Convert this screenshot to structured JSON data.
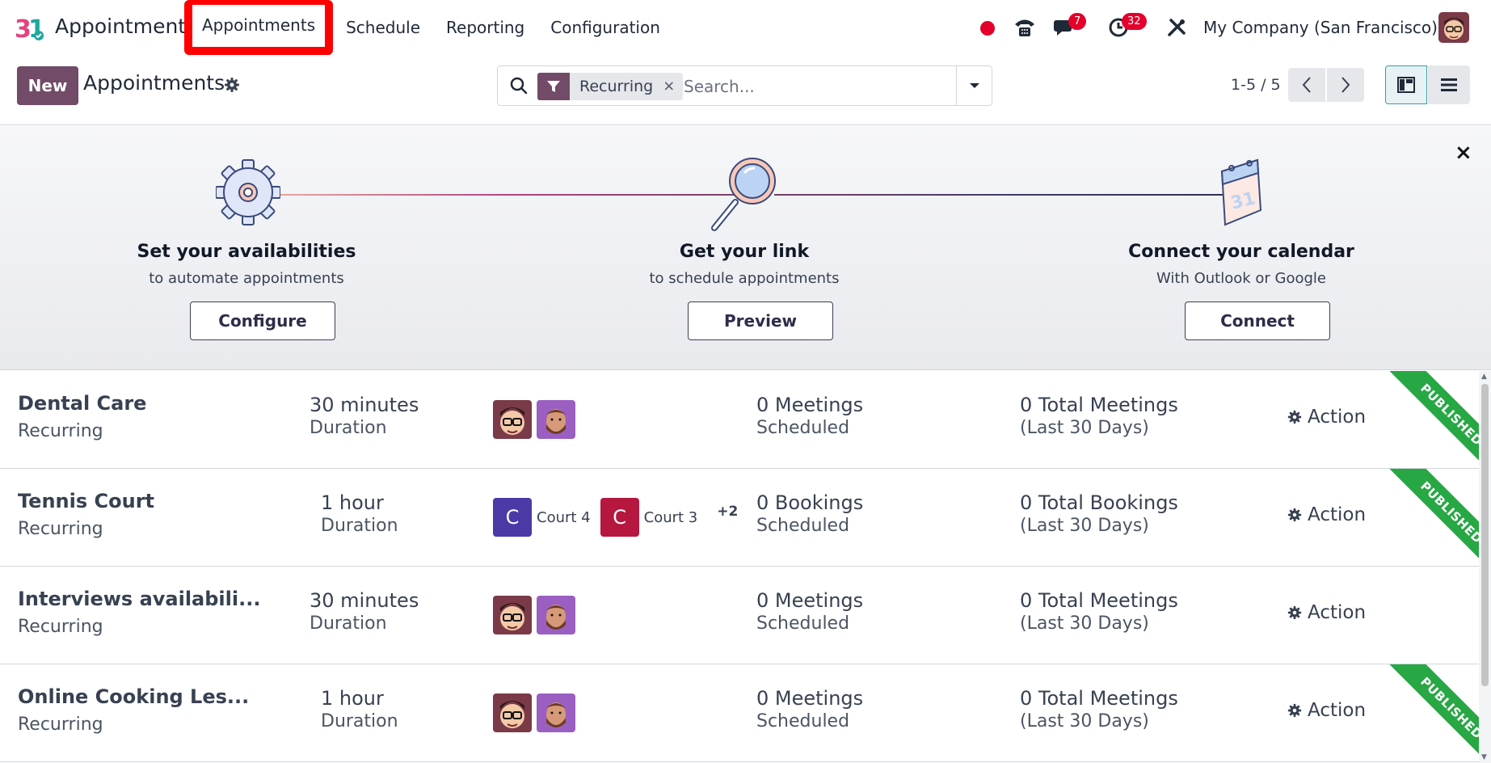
{
  "app": {
    "name": "Appointments",
    "menu": [
      "Appointments",
      "Schedule",
      "Reporting",
      "Configuration"
    ],
    "company": "My Company (San Francisco)",
    "badges": {
      "messages": "7",
      "activities": "32"
    }
  },
  "control": {
    "new_label": "New",
    "title": "Appointments",
    "facet_label": "Recurring",
    "facet_remove": "×",
    "search_placeholder": "Search...",
    "pager": "1-5 / 5"
  },
  "helper": {
    "close": "×",
    "steps": [
      {
        "title": "Set your availabilities",
        "subtitle": "to automate appointments",
        "button": "Configure"
      },
      {
        "title": "Get your link",
        "subtitle": "to schedule appointments",
        "button": "Preview"
      },
      {
        "title": "Connect your calendar",
        "subtitle": "With Outlook or Google",
        "button": "Connect"
      }
    ],
    "calendar_number": "31"
  },
  "rows": [
    {
      "name": "Dental Care",
      "type": "Recurring",
      "duration": "30 minutes",
      "duration_label": "Duration",
      "count": "0 Meetings",
      "count_label": "Scheduled",
      "total": "0 Total Meetings",
      "total_label": "(Last 30 Days)",
      "action": "Action",
      "ribbon": "PUBLISHED"
    },
    {
      "name": "Tennis Court",
      "type": "Recurring",
      "duration": "1 hour",
      "duration_label": "Duration",
      "count": "0 Bookings",
      "count_label": "Scheduled",
      "total": "0 Total Bookings",
      "total_label": "(Last 30 Days)",
      "action": "Action",
      "ribbon": "PUBLISHED",
      "resources": [
        {
          "initial": "C",
          "label": "Court 4",
          "color": "#4b3aa6"
        },
        {
          "initial": "C",
          "label": "Court 3",
          "color": "#b5173e"
        }
      ],
      "more": "+2"
    },
    {
      "name": "Interviews availabili...",
      "type": "Recurring",
      "duration": "30 minutes",
      "duration_label": "Duration",
      "count": "0 Meetings",
      "count_label": "Scheduled",
      "total": "0 Total Meetings",
      "total_label": "(Last 30 Days)",
      "action": "Action",
      "ribbon": ""
    },
    {
      "name": "Online Cooking Les...",
      "type": "Recurring",
      "duration": "1 hour",
      "duration_label": "Duration",
      "count": "0 Meetings",
      "count_label": "Scheduled",
      "total": "0 Total Meetings",
      "total_label": "(Last 30 Days)",
      "action": "Action",
      "ribbon": "PUBLISHED"
    }
  ],
  "colors": {
    "brand": "#714b67",
    "published": "#28a745",
    "alert": "#e3002b"
  },
  "icons": [
    "app-logo-icon",
    "phone-icon",
    "chat-icon",
    "clock-icon",
    "tools-icon",
    "gear-icon",
    "search-icon",
    "filter-icon",
    "caret-down-icon",
    "chevron-left-icon",
    "chevron-right-icon",
    "kanban-view-icon",
    "list-view-icon",
    "close-icon"
  ]
}
